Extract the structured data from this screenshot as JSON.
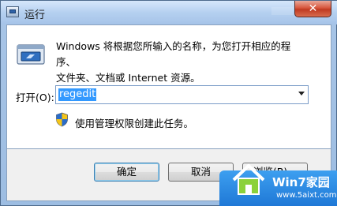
{
  "window": {
    "title": "运行",
    "close_label": "✕"
  },
  "dialog": {
    "description_line1": "Windows 将根据您所输入的名称，为您打开相应的程序、",
    "description_line2": "文件夹、文档或 Internet 资源。",
    "open_label": "打开(O):",
    "open_value": "regedit",
    "admin_note": "使用管理权限创建此任务。"
  },
  "buttons": {
    "ok": "确定",
    "cancel": "取消",
    "browse": "浏览(B)..."
  },
  "watermark": {
    "title": "Win7家园",
    "url": "www.5aixt.com"
  },
  "icons": [
    "run-app-icon",
    "run-icon",
    "shield-icon",
    "close-icon",
    "dropdown-arrow-icon",
    "house-logo-icon"
  ]
}
